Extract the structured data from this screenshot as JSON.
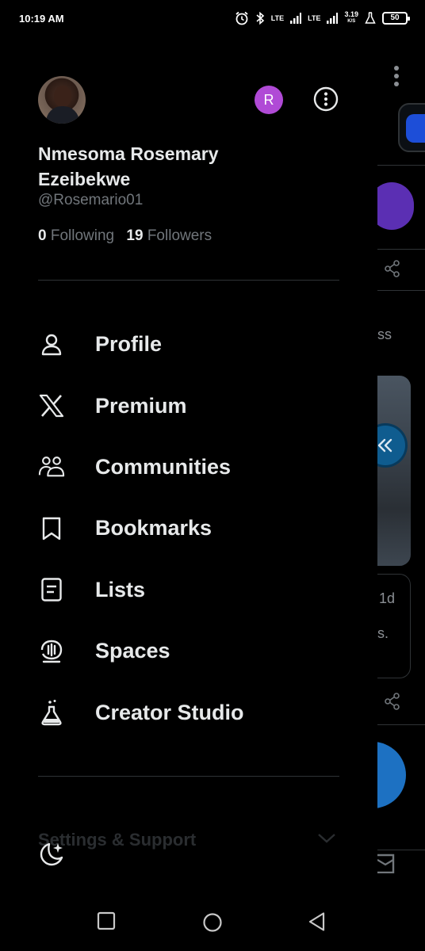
{
  "status_bar": {
    "time": "10:19 AM",
    "speed_value": "3.19",
    "speed_unit": "K/S",
    "battery": "50",
    "network_1": "LTE",
    "network_2": "LTE"
  },
  "profile": {
    "avatar_initial": "R",
    "name": "Nmesoma Rosemary Ezeibekwe",
    "handle": "@Rosemario01",
    "following_count": "0",
    "following_label": "Following",
    "followers_count": "19",
    "followers_label": "Followers"
  },
  "menu": {
    "items": [
      {
        "label": "Profile",
        "icon": "person-icon"
      },
      {
        "label": "Premium",
        "icon": "x-logo-icon"
      },
      {
        "label": "Communities",
        "icon": "communities-icon"
      },
      {
        "label": "Bookmarks",
        "icon": "bookmark-icon"
      },
      {
        "label": "Lists",
        "icon": "list-icon"
      },
      {
        "label": "Spaces",
        "icon": "spaces-icon"
      },
      {
        "label": "Creator Studio",
        "icon": "flask-icon"
      }
    ]
  },
  "settings_section": {
    "label": "Settings & Support"
  },
  "background": {
    "text_fragment_1": "ss",
    "text_fragment_2": "1d",
    "text_fragment_3": "s."
  },
  "colors": {
    "background": "#000000",
    "text_primary": "#e7e9ea",
    "text_secondary": "#71767b",
    "divider": "#2f3336",
    "account_switch": "#b04ad6",
    "accent_blue": "#1d71c2"
  }
}
